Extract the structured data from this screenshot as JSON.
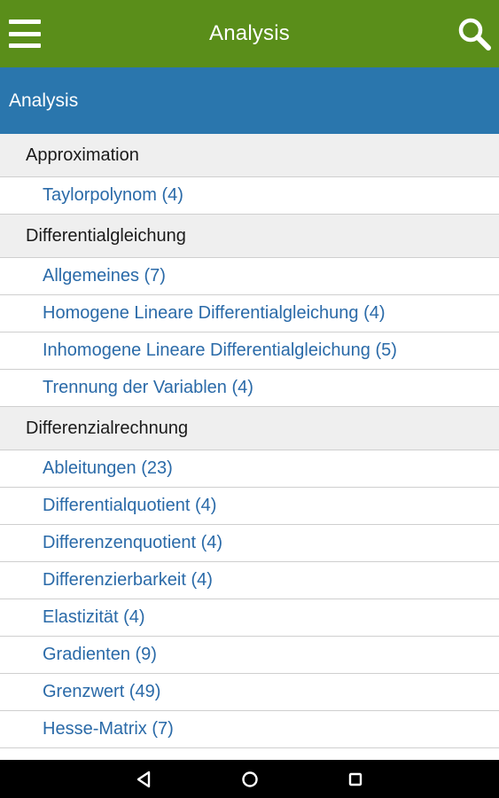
{
  "appbar": {
    "title": "Analysis",
    "background": "#5a8e1a",
    "menu_icon": "hamburger-menu-icon",
    "search_icon": "search-icon"
  },
  "section": {
    "title": "Analysis",
    "background": "#2a76ad"
  },
  "groups": [
    {
      "category": "Approximation",
      "items": [
        "Taylorpolynom (4)"
      ]
    },
    {
      "category": "Differentialgleichung",
      "items": [
        "Allgemeines (7)",
        "Homogene Lineare Differentialgleichung (4)",
        "Inhomogene Lineare Differentialgleichung (5)",
        "Trennung der Variablen (4)"
      ]
    },
    {
      "category": "Differenzialrechnung",
      "items": [
        "Ableitungen (23)",
        "Differentialquotient (4)",
        "Differenzenquotient (4)",
        "Differenzierbarkeit (4)",
        "Elastizität (4)",
        "Gradienten (9)",
        "Grenzwert (49)",
        "Hesse-Matrix (7)"
      ]
    }
  ],
  "navbar": {
    "back_icon": "back-triangle-icon",
    "home_icon": "home-circle-icon",
    "recents_icon": "recents-square-icon"
  }
}
